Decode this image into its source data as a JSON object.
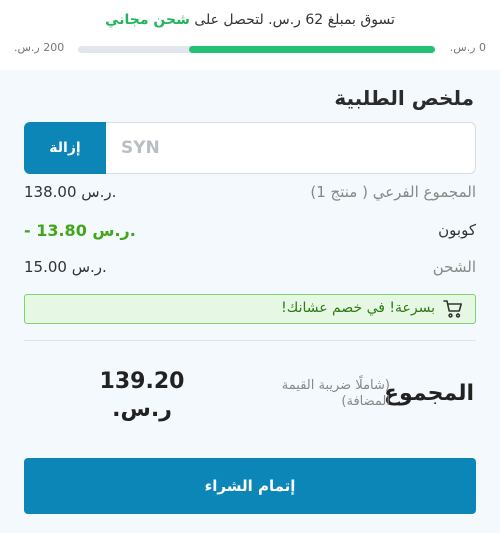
{
  "shipping_banner": {
    "message_prefix": "تسوق بمبلغ 62 ر.س. لتحصل على",
    "message_highlight": "شحن مجاني",
    "progress_start_label": "0 ر.س.",
    "progress_end_label": "200 ر.س.",
    "progress_fraction": 0.69
  },
  "summary": {
    "title": "ملخص الطلبية",
    "coupon": {
      "value": "SYN",
      "remove_label": "إزالة"
    },
    "rows": [
      {
        "label": "المجموع الفرعي ( منتج 1)",
        "value": "138.00 ر.س."
      },
      {
        "label": "كوبون",
        "value": "- 13.80 ر.س."
      },
      {
        "label": "الشحن",
        "value": "15.00 ر.س."
      }
    ],
    "promo_message": "بسرعة! في خصم عشانك!",
    "total_label": "المجموع",
    "tax_note": "(شاملًا ضريبة القيمة المضافة)",
    "total_amount": "139.20 ر.س.",
    "checkout_label": "إتمام الشراء"
  },
  "colors": {
    "accent": "#0b86b6",
    "progress_fill": "#22c173",
    "discount": "#43a51b",
    "promo_bg": "#e6f8e4"
  },
  "icons": {
    "promo": "cart-icon"
  }
}
